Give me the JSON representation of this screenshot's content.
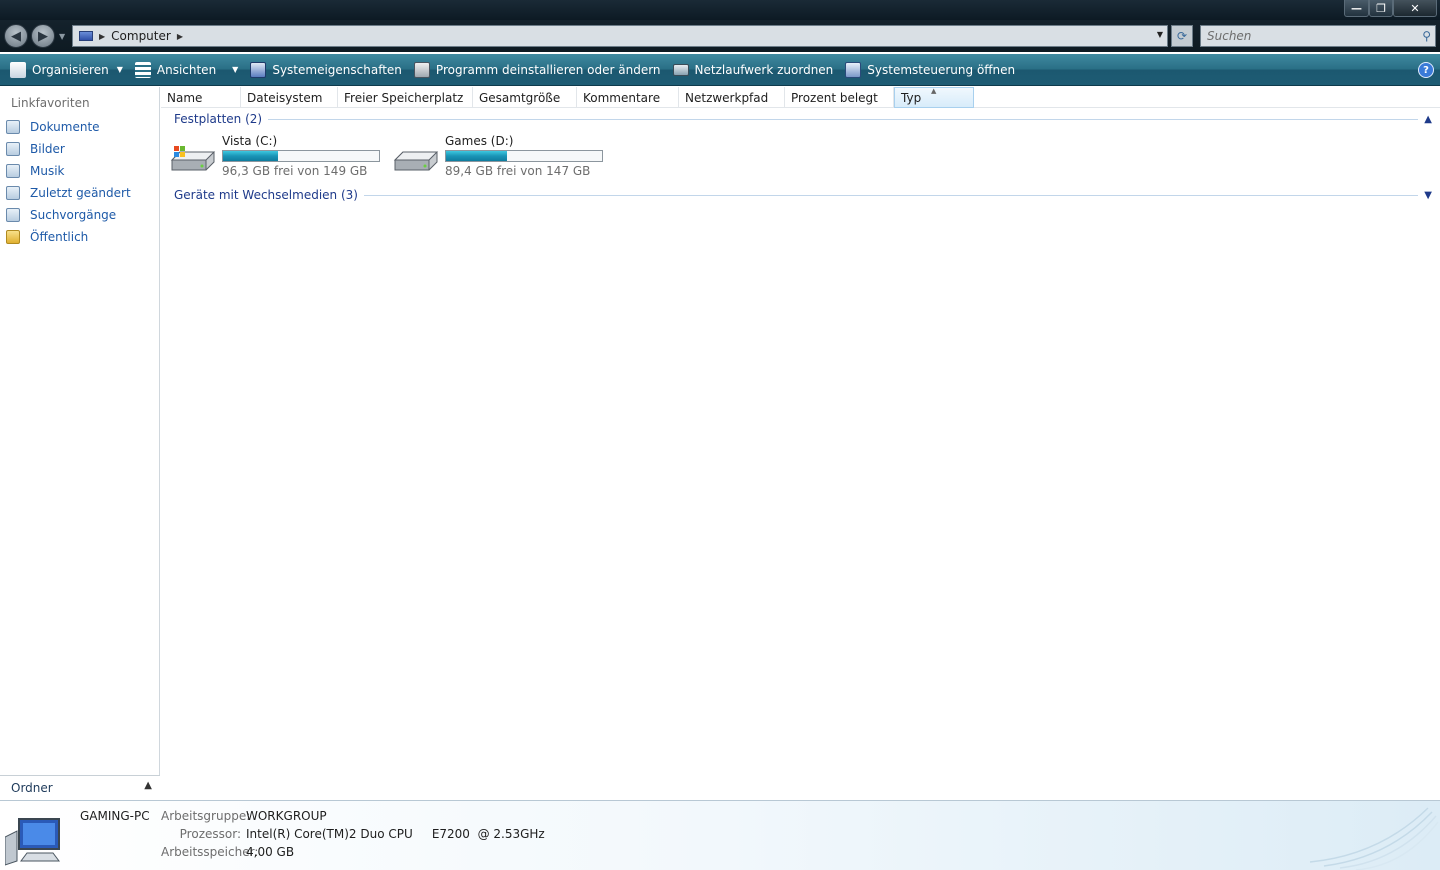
{
  "window": {
    "minimize_label": "—",
    "maximize_label": "❐",
    "close_label": "✕"
  },
  "address": {
    "location": "Computer",
    "search_placeholder": "Suchen"
  },
  "commands": {
    "organize": "Organisieren",
    "views": "Ansichten",
    "system_properties": "Systemeigenschaften",
    "uninstall": "Programm deinstallieren oder ändern",
    "map_drive": "Netzlaufwerk zuordnen",
    "control_panel": "Systemsteuerung öffnen",
    "help": "?"
  },
  "nav": {
    "heading": "Linkfavoriten",
    "items": [
      {
        "label": "Dokumente"
      },
      {
        "label": "Bilder"
      },
      {
        "label": "Musik"
      },
      {
        "label": "Zuletzt geändert"
      },
      {
        "label": "Suchvorgänge"
      },
      {
        "label": "Öffentlich"
      }
    ],
    "folders": "Ordner"
  },
  "columns": [
    "Name",
    "Dateisystem",
    "Freier Speicherplatz",
    "Gesamtgröße",
    "Kommentare",
    "Netzwerkpfad",
    "Prozent belegt",
    "Typ"
  ],
  "groups": {
    "hard_drives": "Festplatten (2)",
    "removable": "Geräte mit Wechselmedien (3)"
  },
  "drives": [
    {
      "name": "Vista (C:)",
      "free_text": "96,3 GB frei von 149 GB",
      "used_fraction": 0.354
    },
    {
      "name": "Games (D:)",
      "free_text": "89,4 GB frei von 147 GB",
      "used_fraction": 0.392
    }
  ],
  "details": {
    "pc_name": "GAMING-PC",
    "workgroup_label": "Arbeitsgruppe:",
    "workgroup_value": "WORKGROUP",
    "processor_label": "Prozessor:",
    "processor_value": "Intel(R) Core(TM)2 Duo CPU     E7200  @ 2.53GHz",
    "memory_label": "Arbeitsspeicher:",
    "memory_value": "4,00 GB"
  }
}
